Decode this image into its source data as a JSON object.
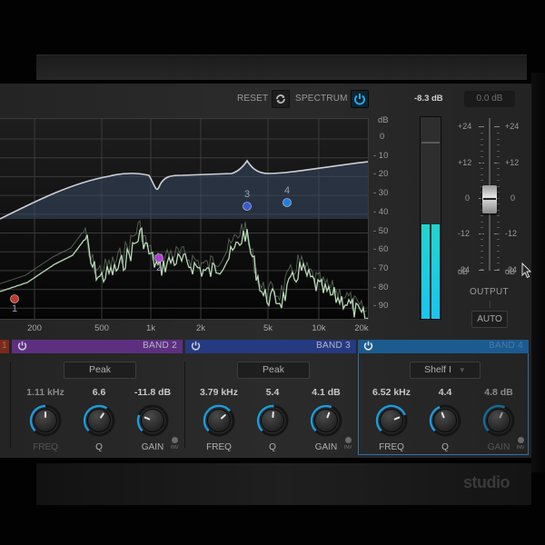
{
  "toolbar": {
    "reset_label": "RESET",
    "spectrum_label": "SPECTRUM",
    "reset_icon": "refresh-icon",
    "spectrum_icon": "power-icon",
    "spectrum_on": true
  },
  "eq_display": {
    "db_unit": "dB",
    "db_ticks": [
      "0",
      "- 10",
      "- 20",
      "- 30",
      "- 40",
      "- 50",
      "- 60",
      "- 70",
      "- 80",
      "- 90"
    ],
    "freq_ticks": [
      "200",
      "500",
      "1k",
      "2k",
      "5k",
      "10k",
      "20k"
    ],
    "band_nodes": [
      {
        "label": "1",
        "color": "#c0392b"
      },
      {
        "label": "2",
        "color": "#b040d8"
      },
      {
        "label": "3",
        "color": "#3b5bd6"
      },
      {
        "label": "4",
        "color": "#1f7fe0"
      }
    ]
  },
  "meter": {
    "readout": "-8.3 dB",
    "level_fraction": 0.47,
    "peak_fraction": 0.88
  },
  "output": {
    "readout": "0.0 dB",
    "scale_left": [
      "+24",
      "+12",
      "0",
      "-12",
      "-24"
    ],
    "scale_right": [
      "+24",
      "+12",
      "0",
      "-12",
      "-24"
    ],
    "unit": "dB",
    "label": "OUTPUT",
    "fader_value_db": 0,
    "auto_label": "AUTO"
  },
  "bands": [
    {
      "name": "BAND 2",
      "color": "#5e2f80",
      "type": "Peak",
      "freq": "1.11 kHz",
      "q": "6.6",
      "gain": "-11.8 dB",
      "freq_label": "FREQ",
      "q_label": "Q",
      "gain_label": "GAIN",
      "inv_label": "INV",
      "knob_freq_fraction": 0.5,
      "knob_q_fraction": 0.62,
      "knob_gain_fraction": 0.25
    },
    {
      "name": "BAND 3",
      "color": "#263a82",
      "type": "Peak",
      "freq": "3.79 kHz",
      "q": "5.4",
      "gain": "4.1 dB",
      "freq_label": "FREQ",
      "q_label": "Q",
      "gain_label": "GAIN",
      "inv_label": "INV",
      "knob_freq_fraction": 0.68,
      "knob_q_fraction": 0.52,
      "knob_gain_fraction": 0.58
    },
    {
      "name": "BAND 4",
      "color": "#1c5b90",
      "type": "Shelf I",
      "freq": "6.52 kHz",
      "q": "4.4",
      "gain": "4.8 dB",
      "freq_label": "FREQ",
      "q_label": "Q",
      "gain_label": "GAIN",
      "inv_label": "INV",
      "knob_freq_fraction": 0.75,
      "knob_q_fraction": 0.42,
      "knob_gain_fraction": 0.59
    }
  ],
  "band1_partial_label": "1",
  "brand": "studio"
}
